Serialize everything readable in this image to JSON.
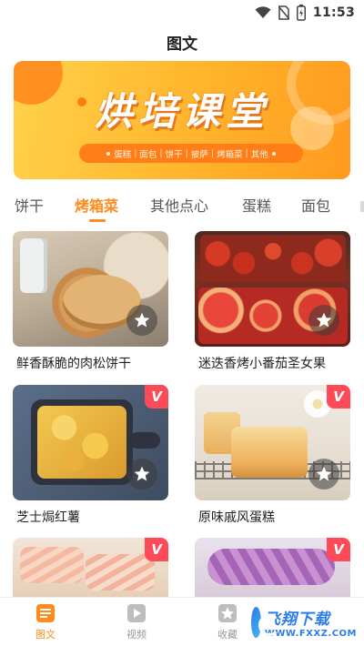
{
  "status_bar": {
    "time": "11:53"
  },
  "header": {
    "title": "图文"
  },
  "banner": {
    "title": "烘培课堂",
    "tags": [
      "蛋糕",
      "面包",
      "饼干",
      "披萨",
      "烤箱菜",
      "其他"
    ]
  },
  "tabs": [
    "饼干",
    "烤箱菜",
    "其他点心",
    "蛋糕",
    "面包"
  ],
  "active_tab": "烤箱菜",
  "cards": [
    {
      "title": "鲜香酥脆的肉松饼干",
      "badge": ""
    },
    {
      "title": "迷迭香烤小番茄圣女果",
      "badge": ""
    },
    {
      "title": "芝士焗红薯",
      "badge": "V"
    },
    {
      "title": "原味戚风蛋糕",
      "badge": "V"
    },
    {
      "title": "",
      "badge": "V"
    },
    {
      "title": "",
      "badge": "V"
    }
  ],
  "bottom_nav": [
    {
      "label": "图文",
      "icon": "article-icon"
    },
    {
      "label": "视频",
      "icon": "video-icon"
    },
    {
      "label": "收藏",
      "icon": "star-icon"
    }
  ],
  "watermark": {
    "main": "飞翔下载",
    "sub": "WWW.FXXZ.COM"
  },
  "colors": {
    "accent": "#ff8a1d",
    "badge": "#ff4a57",
    "banner_bg": "#ffb42c"
  }
}
